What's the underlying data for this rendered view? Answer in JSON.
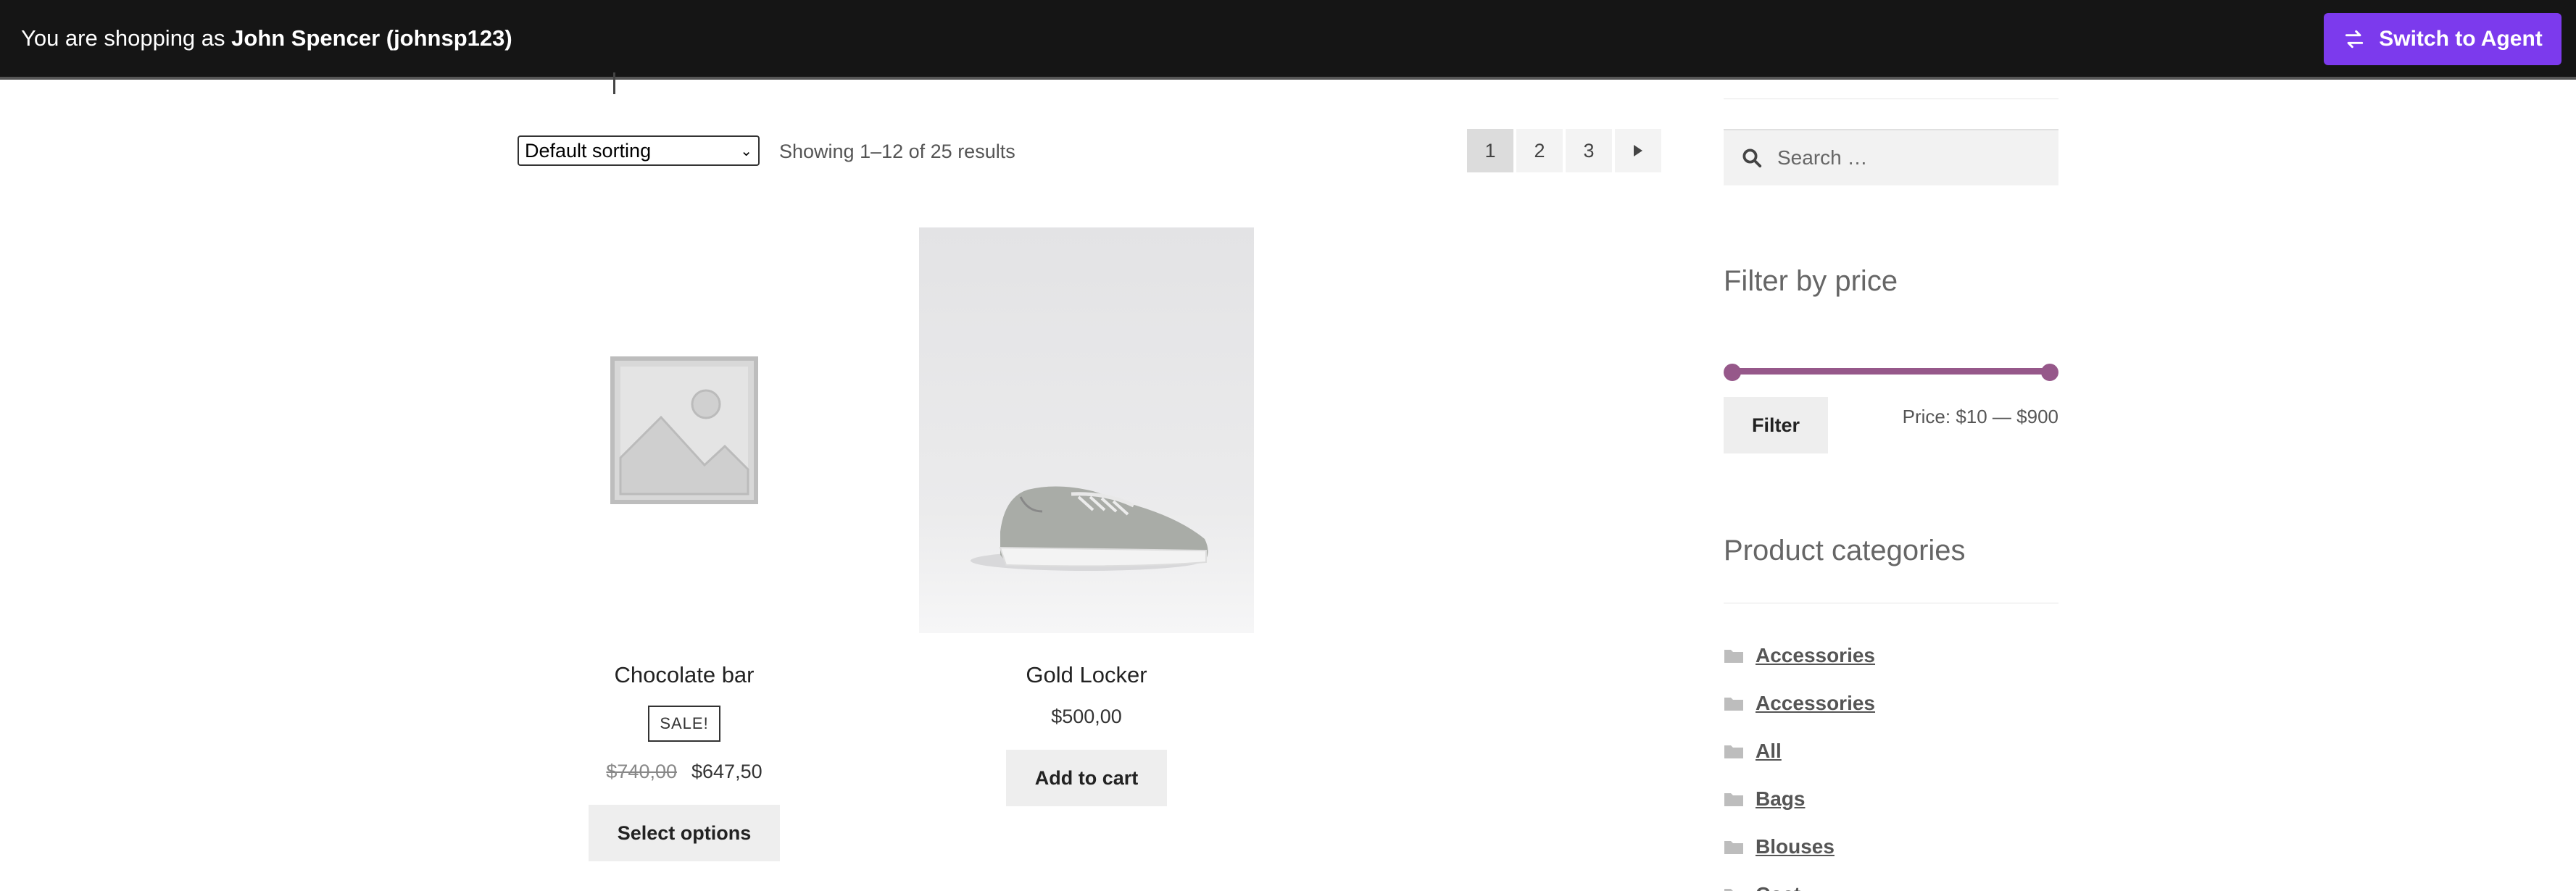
{
  "topbar": {
    "shopping_prefix": "You are shopping as ",
    "shopper_name": "John Spencer (johnsp123)",
    "switch_label": "Switch to Agent",
    "accent": "#7c3aed"
  },
  "toolbar": {
    "sort_selected": "Default sorting",
    "result_count": "Showing 1–12 of 25 results"
  },
  "pagination": {
    "pages": [
      "1",
      "2",
      "3"
    ],
    "current": "1",
    "next_icon": "arrow-right-icon"
  },
  "products": [
    {
      "title": "Chocolate bar",
      "badge": "SALE!",
      "old_price": "$740,00",
      "price": "$647,50",
      "button": "Select options",
      "image": "placeholder-image-icon"
    },
    {
      "title": "Gold Locker",
      "price": "$500,00",
      "button": "Add to cart",
      "image": "sneaker-photo"
    }
  ],
  "sidebar": {
    "search_placeholder": "Search …",
    "filter_title": "Filter by price",
    "filter_button": "Filter",
    "price_label": "Price: $10 — $900",
    "slider_color": "#96588a",
    "categories_title": "Product categories",
    "categories": [
      "Accessories",
      "Accessories",
      "All",
      "Bags",
      "Blouses",
      "Coat"
    ]
  }
}
